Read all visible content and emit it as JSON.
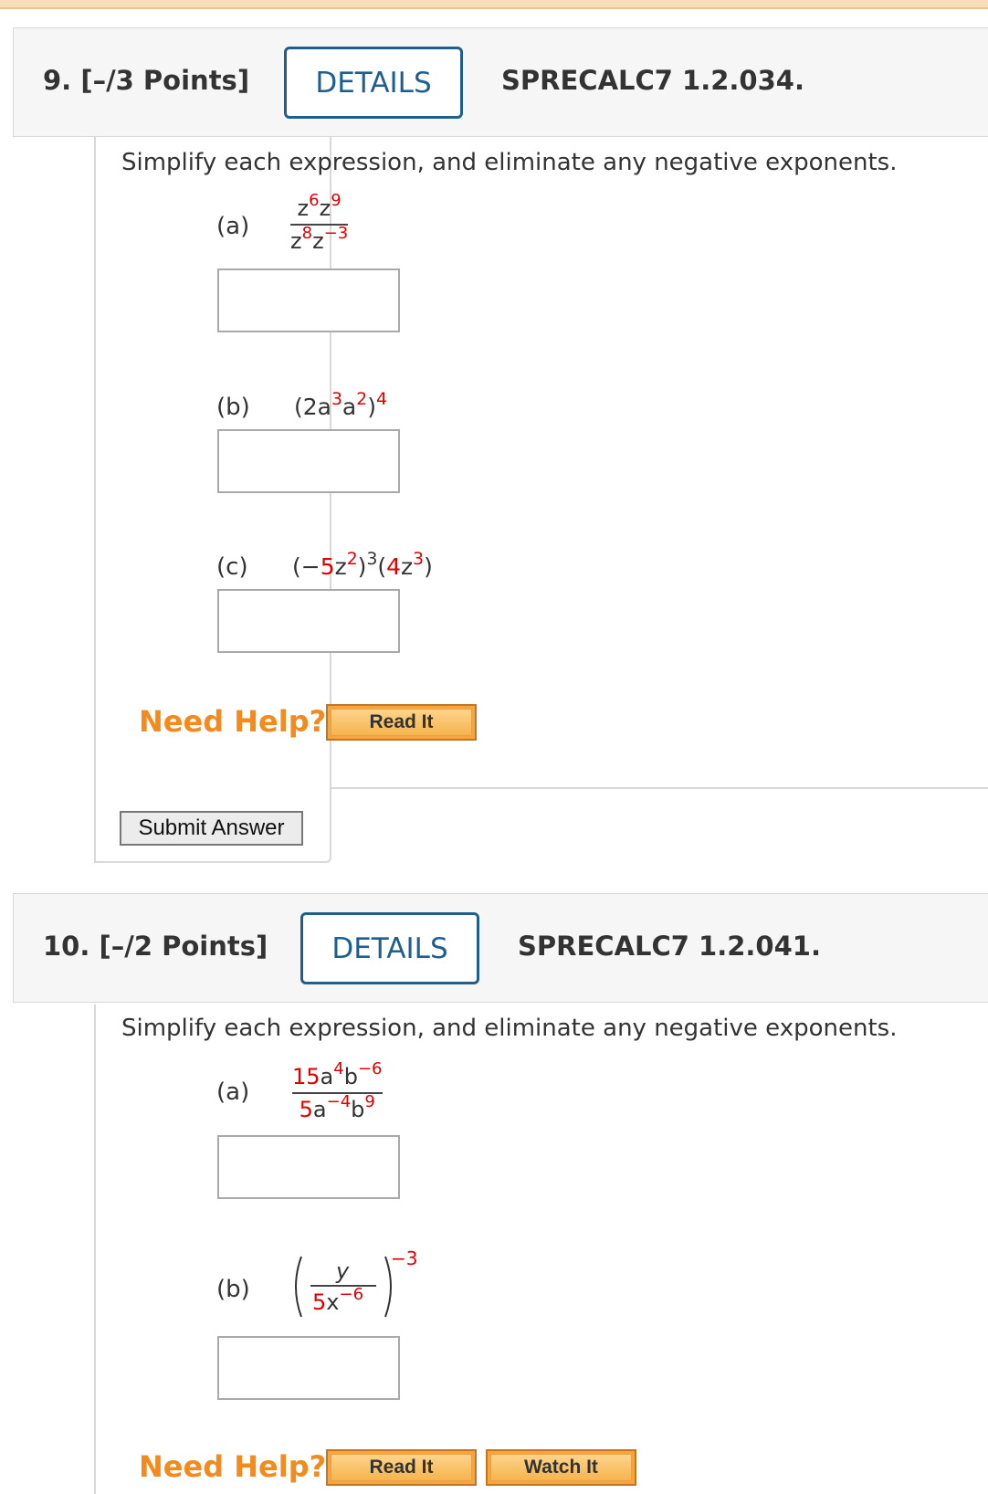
{
  "q9": {
    "number": "9.",
    "points": "[–/3 Points]",
    "details_label": "DETAILS",
    "code": "SPRECALC7 1.2.034.",
    "instruction": "Simplify each expression, and eliminate any negative exponents.",
    "part_a": {
      "label": "(a)"
    },
    "part_b": {
      "label": "(b)"
    },
    "part_c": {
      "label": "(c)"
    },
    "need_help": "Need Help?",
    "read_it": "Read It",
    "submit": "Submit Answer"
  },
  "q10": {
    "number": "10.",
    "points": "[–/2 Points]",
    "details_label": "DETAILS",
    "code": "SPRECALC7 1.2.041.",
    "instruction": "Simplify each expression, and eliminate any negative exponents.",
    "part_a": {
      "label": "(a)"
    },
    "part_b": {
      "label": "(b)"
    },
    "need_help": "Need Help?",
    "read_it": "Read It",
    "watch_it": "Watch It"
  },
  "colors": {
    "accent": "#1f5f8f",
    "help": "#f28a1e",
    "highlight": "#e00000",
    "button": "#f9a53a"
  }
}
